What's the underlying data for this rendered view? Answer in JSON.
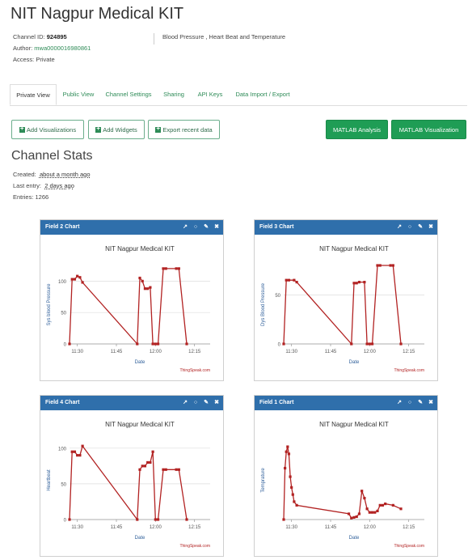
{
  "page": {
    "title": "NIT Nagpur Medical KIT",
    "channel_id_label": "Channel ID:",
    "channel_id": "924895",
    "author_label": "Author:",
    "author": "mwa0000016980861",
    "access": "Access: Private",
    "description": "Blood Pressure , Heart Beat and Temperature"
  },
  "tabs": [
    "Private View",
    "Public View",
    "Channel Settings",
    "Sharing",
    "API Keys",
    "Data Import / Export"
  ],
  "buttons": {
    "add_visualizations": "Add Visualizations",
    "add_widgets": "Add Widgets",
    "export": "Export recent data",
    "matlab_analysis": "MATLAB Analysis",
    "matlab_visualization": "MATLAB Visualization"
  },
  "stats": {
    "heading": "Channel Stats",
    "created_label": "Created:",
    "created": "about a month ago",
    "last_entry_label": "Last entry:",
    "last_entry": "2 days ago",
    "entries": "Entries: 1266"
  },
  "colors": {
    "header": "#2f6fab",
    "line": "#b22222",
    "accent": "#2e8b57",
    "button_green": "#1f9d55"
  },
  "chart_data": [
    {
      "panel_title": "Field 2 Chart",
      "type": "line",
      "title": "NIT Nagpur Medical KIT",
      "xlabel": "Date",
      "ylabel": "Sys blood Pressure",
      "credit": "ThingSpeak.com",
      "ylim": [
        0,
        125
      ],
      "yticks": [
        0,
        50,
        100
      ],
      "xlim": [
        0,
        54
      ],
      "xticks": [
        3,
        18,
        33,
        48
      ],
      "xtick_labels": [
        "11:30",
        "11:45",
        "12:00",
        "12:15"
      ],
      "x": [
        0,
        1,
        2,
        3,
        4,
        5,
        26,
        27,
        28,
        29,
        30,
        31,
        32,
        33,
        34,
        36,
        37,
        41,
        42,
        45
      ],
      "y": [
        0,
        103,
        103,
        108,
        106,
        98,
        0,
        105,
        100,
        88,
        88,
        90,
        0,
        0,
        0,
        120,
        120,
        120,
        120,
        0
      ]
    },
    {
      "panel_title": "Field 3 Chart",
      "type": "line",
      "title": "NIT Nagpur Medical KIT",
      "xlabel": "Date",
      "ylabel": "Dys Blood Pressure",
      "credit": "ThingSpeak.com",
      "ylim": [
        0,
        80
      ],
      "yticks": [
        0,
        50
      ],
      "xlim": [
        0,
        54
      ],
      "xticks": [
        3,
        18,
        33,
        48
      ],
      "xtick_labels": [
        "11:30",
        "11:45",
        "12:00",
        "12:15"
      ],
      "x": [
        0,
        1,
        2,
        4,
        5,
        26,
        27,
        28,
        29,
        31,
        32,
        33,
        34,
        36,
        37,
        41,
        42,
        45
      ],
      "y": [
        0,
        65,
        65,
        65,
        63,
        0,
        62,
        62,
        63,
        63,
        0,
        0,
        0,
        80,
        80,
        80,
        80,
        0
      ]
    },
    {
      "panel_title": "Field 4 Chart",
      "type": "line",
      "title": "NIT Nagpur Medical KIT",
      "xlabel": "Date",
      "ylabel": "Heartbeat",
      "credit": "ThingSpeak.com",
      "ylim": [
        0,
        110
      ],
      "yticks": [
        0,
        50,
        100
      ],
      "xlim": [
        0,
        54
      ],
      "xticks": [
        3,
        18,
        33,
        48
      ],
      "xtick_labels": [
        "11:30",
        "11:45",
        "12:00",
        "12:15"
      ],
      "x": [
        0,
        1,
        2,
        3,
        4,
        5,
        26,
        27,
        28,
        29,
        30,
        31,
        32,
        33,
        34,
        36,
        37,
        41,
        42,
        45
      ],
      "y": [
        0,
        95,
        95,
        90,
        90,
        103,
        0,
        70,
        75,
        75,
        80,
        80,
        95,
        0,
        0,
        70,
        70,
        70,
        70,
        0
      ]
    },
    {
      "panel_title": "Field 1 Chart",
      "type": "line",
      "title": "NIT Nagpur Medical KIT",
      "xlabel": "Date",
      "ylabel": "Temprature",
      "credit": "ThingSpeak.com",
      "ylim": [
        0,
        110
      ],
      "yticks": [],
      "xlim": [
        0,
        54
      ],
      "xticks": [
        3,
        18,
        33,
        48
      ],
      "xtick_labels": [
        "11:30",
        "11:45",
        "12:00",
        "12:15"
      ],
      "x": [
        0,
        0.5,
        1,
        1.5,
        2,
        2.5,
        3,
        3.5,
        4,
        5,
        25,
        26,
        27,
        28,
        29,
        30,
        31,
        32,
        33,
        34,
        35,
        36,
        37,
        38,
        39,
        42,
        45
      ],
      "y": [
        0,
        72,
        95,
        102,
        92,
        60,
        45,
        35,
        25,
        20,
        8,
        2,
        3,
        4,
        8,
        40,
        30,
        15,
        10,
        10,
        10,
        12,
        20,
        20,
        22,
        20,
        15
      ]
    }
  ]
}
